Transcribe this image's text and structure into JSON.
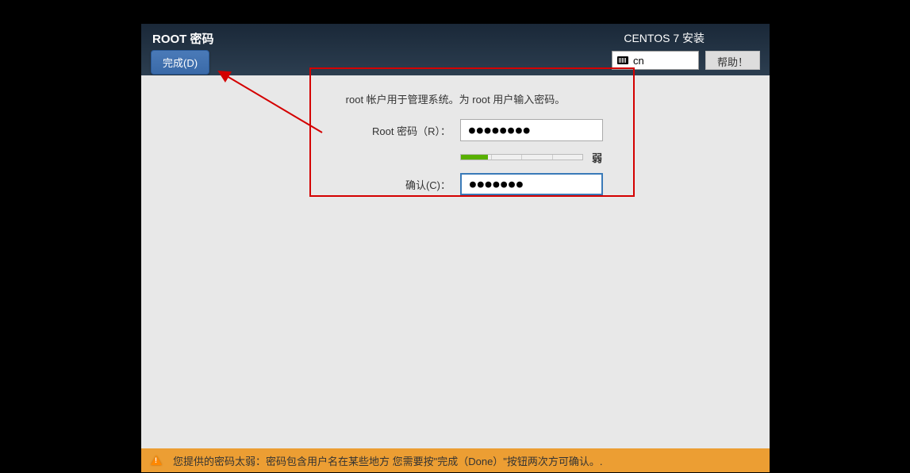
{
  "header": {
    "title": "ROOT 密码",
    "done_button": "完成(D)",
    "installer_title": "CENTOS 7 安装",
    "lang": "cn",
    "help_button": "帮助！"
  },
  "form": {
    "instruction": "root 帐户用于管理系统。为 root 用户输入密码。",
    "password_label": "Root 密码（R）：",
    "password_value": "●●●●●●●●",
    "confirm_label": "确认(C)：",
    "confirm_value": "●●●●●●●",
    "strength_label": "弱"
  },
  "warning": {
    "text": "您提供的密码太弱：密码包含用户名在某些地方 您需要按\"完成（Done）\"按钮两次方可确认。."
  }
}
